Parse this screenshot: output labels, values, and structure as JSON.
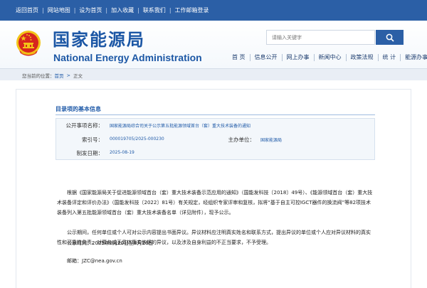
{
  "topbar": {
    "links": [
      "返回首页",
      "网站地图",
      "设为首页",
      "加入收藏",
      "联系我们",
      "工作邮箱登录"
    ]
  },
  "header": {
    "title_cn": "国家能源局",
    "title_en": "National Energy Administration",
    "search_placeholder": "请输入关键字",
    "nav": [
      "首 页",
      "信息公开",
      "网上办事",
      "新闻中心",
      "政策法规",
      "统 计",
      "能源办事"
    ]
  },
  "breadcrumb": {
    "prefix": "您当前的位置：",
    "home": "首页",
    "current": "正文"
  },
  "catalog": {
    "section_title": "目录项的基本信息",
    "publish_label": "公开事项名称：",
    "publish_value": "国家能源局综合司关于公示第五批能源领域首台（套）重大技术装备的通知",
    "index_label": "索引号：",
    "index_value": "000019705/2025-000230",
    "agency_label": "主办单位：",
    "agency_value": "国家能源局",
    "date_label": "制发日期：",
    "date_value": "2025-08-19"
  },
  "article": {
    "para1": "根据《国家能源局关于促进能源领域首台（套）重大技术装备示范应用的通知》（国能发科技〔2018〕49号）、《能源领域首台（套）重大技术装备评定和评价办法》（国能发科技〔2022〕81号）有关规定，经组织专家评审和复核，拟将“基于自主可控IGCT器件的换流阀”等82项技术装备列入第五批能源领域首台（套）重大技术装备名单（详见附件），现予公示。",
    "para2": "公示期间，任何单位或个人可对公示内容提出书面异议。异议材料应注明真实姓名和联系方式，提出异议的单位或个人应对异议材料的真实性和可靠性负责。对匿名或无具体事实依据的异议，以及涉及自身利益的不正当要求，不予受理。",
    "period": "公示时间：2025年8月20日至8月26日",
    "email": "邮箱：JZC@nea.gov.cn"
  },
  "colors": {
    "brand_blue": "#2b5fa6",
    "title_blue": "#1c57a5",
    "link_blue": "#1f5aa8",
    "emblem_red": "#d7261e",
    "emblem_gold": "#f3c417"
  }
}
